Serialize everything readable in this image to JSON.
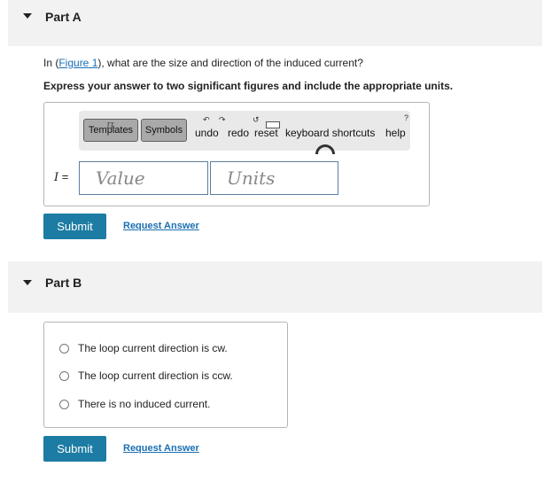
{
  "part_a": {
    "title": "Part A",
    "question_prefix": "In (",
    "figure_link": "Figure 1",
    "question_suffix": "), what are the size and direction of the induced current?",
    "instruction": "Express your answer to two significant figures and include the appropriate units.",
    "toolbar": {
      "templates_label": "Templates",
      "symbols_label": "Symbols",
      "undo_label": "undo",
      "redo_label": "redo",
      "reset_label": "reset",
      "keyboard_shortcuts_label": "keyboard shortcuts",
      "help_label": "help",
      "pi_glyph": "π"
    },
    "variable_label": "I",
    "equals": " =",
    "value_placeholder": "Value",
    "units_placeholder": "Units",
    "submit_label": "Submit",
    "request_answer_label": "Request Answer"
  },
  "part_b": {
    "title": "Part B",
    "choices": [
      "The loop current direction is cw.",
      "The loop current direction is ccw.",
      "There is no induced current."
    ],
    "submit_label": "Submit",
    "request_answer_label": "Request Answer"
  },
  "colors": {
    "submit_bg": "#1c7ca3",
    "link": "#1a6fb3",
    "header_bg": "#f2f2f2"
  }
}
